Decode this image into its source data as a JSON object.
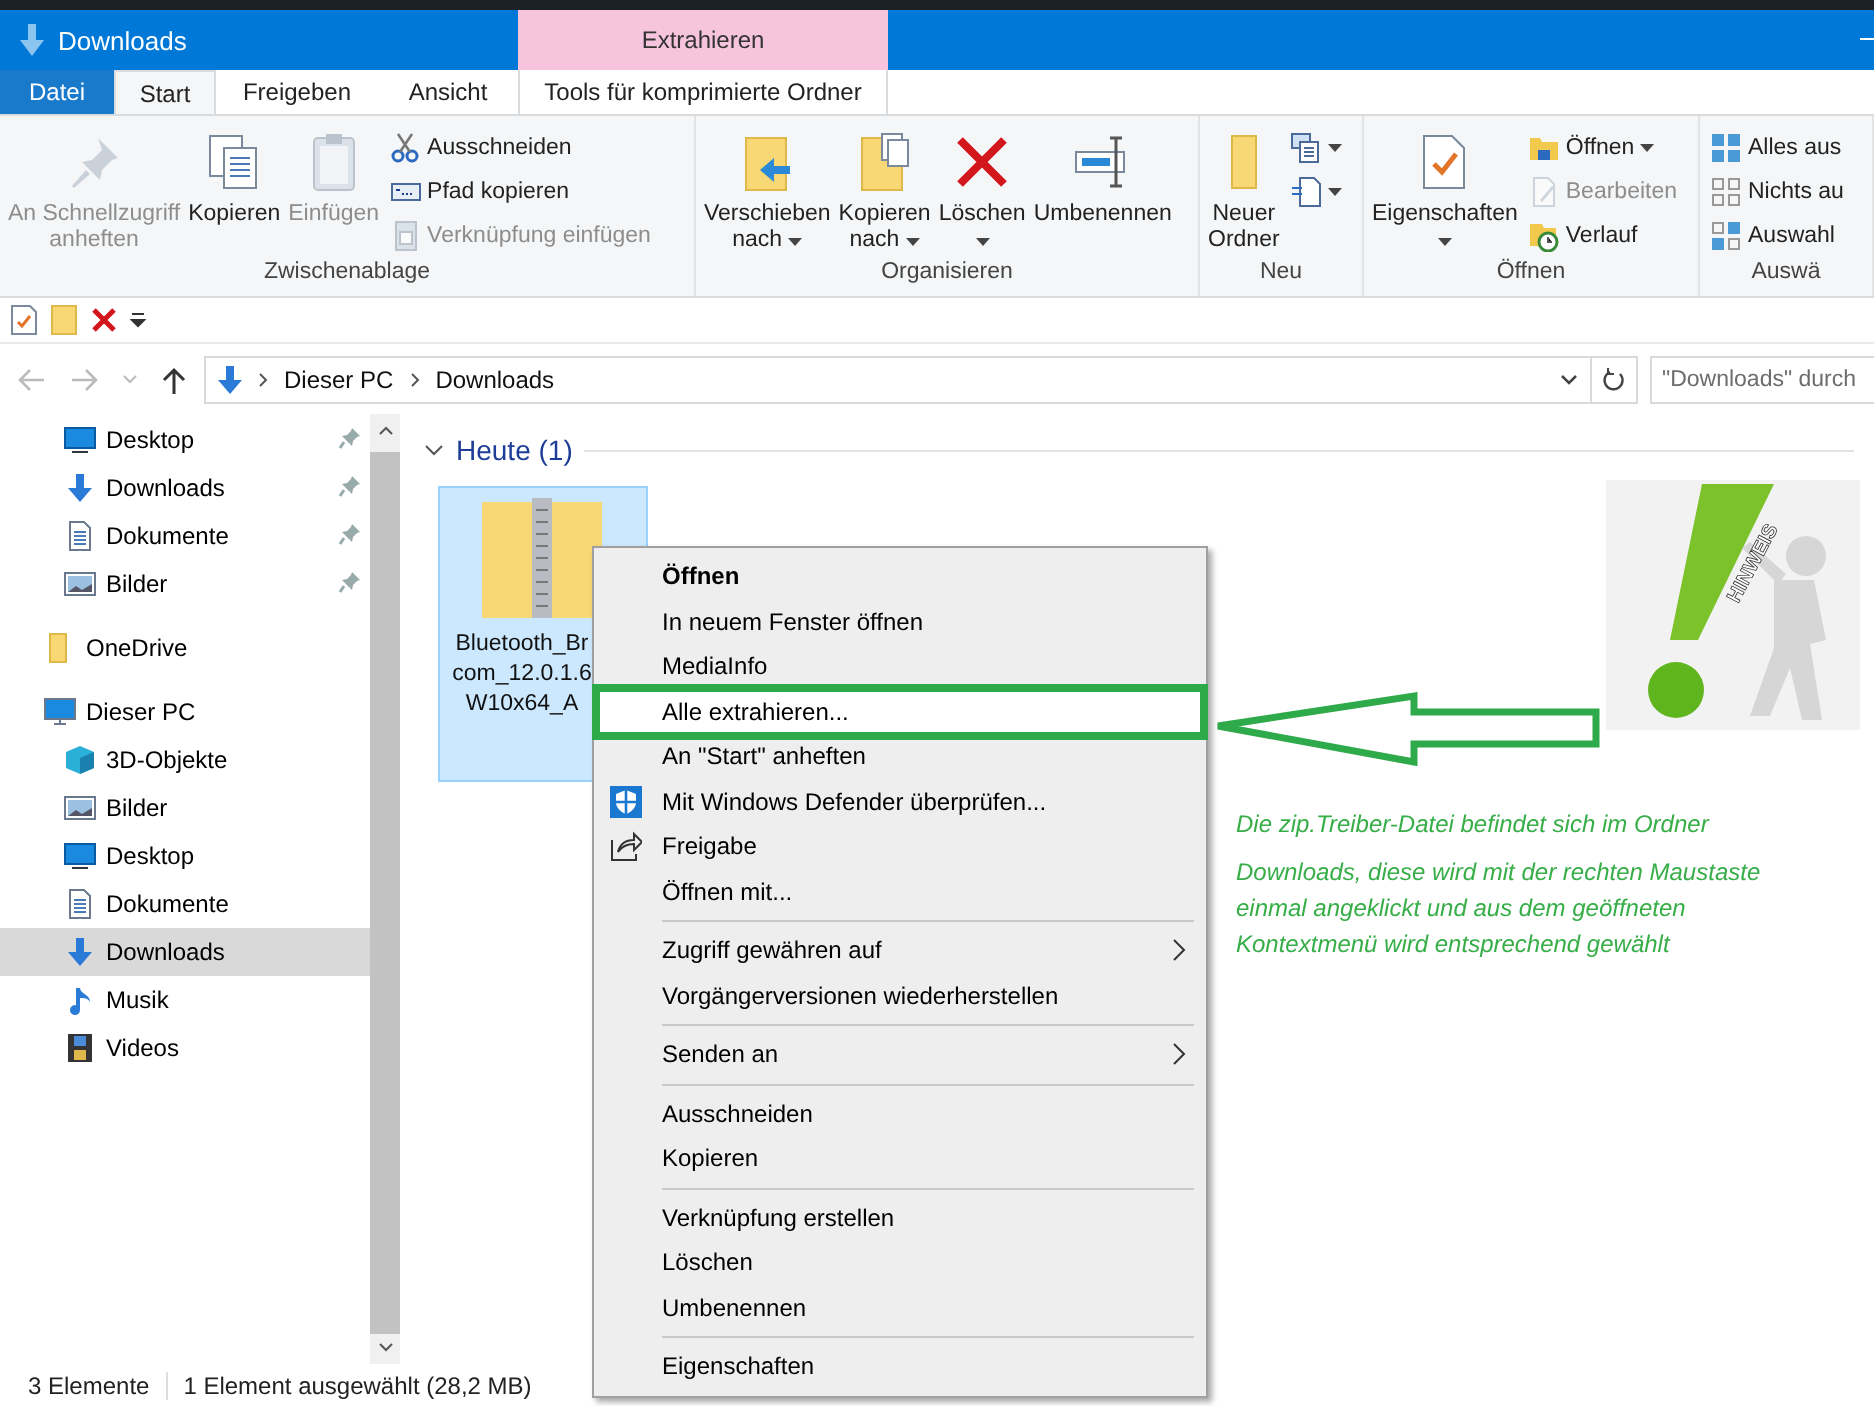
{
  "window": {
    "title": "Downloads"
  },
  "context_tab": {
    "header": "Extrahieren"
  },
  "ribbon_tabs": [
    {
      "label": "Datei",
      "kind": "file",
      "selected": false
    },
    {
      "label": "Start",
      "kind": "tab",
      "selected": true
    },
    {
      "label": "Freigeben",
      "kind": "tab",
      "selected": false
    },
    {
      "label": "Ansicht",
      "kind": "tab",
      "selected": false
    },
    {
      "label": "Tools für komprimierte Ordner",
      "kind": "context",
      "selected": false
    }
  ],
  "ribbon_groups": [
    {
      "label": "Zwischenablage",
      "large": [
        {
          "lines": [
            "An Schnellzugriff",
            "anheften"
          ],
          "disabled": true,
          "dropdown": false
        },
        {
          "lines": [
            "Kopieren"
          ],
          "disabled": false,
          "dropdown": false
        },
        {
          "lines": [
            "Einfügen"
          ],
          "disabled": true,
          "dropdown": false
        }
      ],
      "small": [
        {
          "kind": "text",
          "label": "Ausschneiden",
          "disabled": false,
          "dropdown": false
        },
        {
          "kind": "text",
          "label": "Pfad kopieren",
          "disabled": false,
          "dropdown": false
        },
        {
          "kind": "text",
          "label": "Verknüpfung einfügen",
          "disabled": true,
          "dropdown": false
        }
      ]
    },
    {
      "label": "Organisieren",
      "large": [
        {
          "lines": [
            "Verschieben",
            "nach"
          ],
          "disabled": false,
          "dropdown": true
        },
        {
          "lines": [
            "Kopieren",
            "nach"
          ],
          "disabled": false,
          "dropdown": true
        },
        {
          "lines": [
            "Löschen"
          ],
          "disabled": false,
          "dropdown": true
        },
        {
          "lines": [
            "Umbenennen"
          ],
          "disabled": false,
          "dropdown": false
        }
      ]
    },
    {
      "label": "Neu",
      "large": [
        {
          "lines": [
            "Neuer",
            "Ordner"
          ],
          "disabled": false,
          "dropdown": false
        }
      ],
      "small": [
        {
          "kind": "icon",
          "disabled": false,
          "dropdown": true
        },
        {
          "kind": "icon",
          "disabled": false,
          "dropdown": true
        }
      ]
    },
    {
      "label": "Öffnen",
      "large": [
        {
          "lines": [
            "Eigenschaften"
          ],
          "disabled": false,
          "dropdown": true
        }
      ],
      "small": [
        {
          "kind": "text",
          "label": "Öffnen",
          "disabled": false,
          "dropdown": true
        },
        {
          "kind": "text",
          "label": "Bearbeiten",
          "disabled": true,
          "dropdown": false
        },
        {
          "kind": "text",
          "label": "Verlauf",
          "disabled": false,
          "dropdown": false
        }
      ]
    },
    {
      "label": "Auswä",
      "small": [
        {
          "kind": "text",
          "label": "Alles aus",
          "disabled": false,
          "dropdown": false
        },
        {
          "kind": "text",
          "label": "Nichts au",
          "disabled": false,
          "dropdown": false
        },
        {
          "kind": "text",
          "label": "Auswahl",
          "disabled": false,
          "dropdown": false
        }
      ]
    }
  ],
  "address": {
    "crumbs": [
      "Dieser PC",
      "Downloads"
    ]
  },
  "search": {
    "placeholder": "\"Downloads\" durch"
  },
  "nav": {
    "quick_access": [
      {
        "label": "Desktop",
        "pinned": true,
        "selected": false
      },
      {
        "label": "Downloads",
        "pinned": true,
        "selected": false
      },
      {
        "label": "Dokumente",
        "pinned": true,
        "selected": false
      },
      {
        "label": "Bilder",
        "pinned": true,
        "selected": false
      }
    ],
    "tree": [
      {
        "label": "OneDrive",
        "selected": false
      },
      {
        "label": "Dieser PC",
        "selected": false,
        "children": [
          {
            "label": "3D-Objekte",
            "selected": false
          },
          {
            "label": "Bilder",
            "selected": false
          },
          {
            "label": "Desktop",
            "selected": false
          },
          {
            "label": "Dokumente",
            "selected": false
          },
          {
            "label": "Downloads",
            "selected": true
          },
          {
            "label": "Musik",
            "selected": false
          },
          {
            "label": "Videos",
            "selected": false
          }
        ]
      }
    ]
  },
  "content": {
    "group": {
      "label": "Heute (1)",
      "expanded": true
    },
    "files": [
      {
        "name_lines": [
          "Bluetooth_Br",
          "com_12.0.1.6",
          "W10x64_A"
        ],
        "selected": true
      }
    ]
  },
  "context_menu": {
    "sections": [
      [
        {
          "label": "Öffnen",
          "default": true,
          "submenu": false,
          "highlighted": false
        },
        {
          "label": "In neuem Fenster öffnen",
          "default": false,
          "submenu": false,
          "highlighted": false
        },
        {
          "label": "MediaInfo",
          "default": false,
          "submenu": false,
          "highlighted": false
        },
        {
          "label": "Alle extrahieren...",
          "default": false,
          "submenu": false,
          "highlighted": true
        },
        {
          "label": "An \"Start\" anheften",
          "default": false,
          "submenu": false,
          "highlighted": false
        },
        {
          "label": "Mit Windows Defender überprüfen...",
          "default": false,
          "submenu": false,
          "highlighted": false
        },
        {
          "label": "Freigabe",
          "default": false,
          "submenu": false,
          "highlighted": false
        },
        {
          "label": "Öffnen mit...",
          "default": false,
          "submenu": false,
          "highlighted": false
        }
      ],
      [
        {
          "label": "Zugriff gewähren auf",
          "default": false,
          "submenu": true,
          "highlighted": false
        },
        {
          "label": "Vorgängerversionen wiederherstellen",
          "default": false,
          "submenu": false,
          "highlighted": false
        }
      ],
      [
        {
          "label": "Senden an",
          "default": false,
          "submenu": true,
          "highlighted": false
        }
      ],
      [
        {
          "label": "Ausschneiden",
          "default": false,
          "submenu": false,
          "highlighted": false
        },
        {
          "label": "Kopieren",
          "default": false,
          "submenu": false,
          "highlighted": false
        }
      ],
      [
        {
          "label": "Verknüpfung erstellen",
          "default": false,
          "submenu": false,
          "highlighted": false
        },
        {
          "label": "Löschen",
          "default": false,
          "submenu": false,
          "highlighted": false
        },
        {
          "label": "Umbenennen",
          "default": false,
          "submenu": false,
          "highlighted": false
        }
      ],
      [
        {
          "label": "Eigenschaften",
          "default": false,
          "submenu": false,
          "highlighted": false
        }
      ]
    ]
  },
  "annotation": {
    "sign_text": "HINWEIS",
    "note": [
      "Die zip.Treiber-Datei befindet sich im Ordner",
      "Downloads, diese wird mit der rechten Maustaste einmal angeklickt und aus dem geöffneten Kontextmenü wird entsprechend gewählt"
    ]
  },
  "status_bar": {
    "items": [
      "3 Elemente",
      "1 Element ausgewählt (28,2 MB)"
    ]
  }
}
